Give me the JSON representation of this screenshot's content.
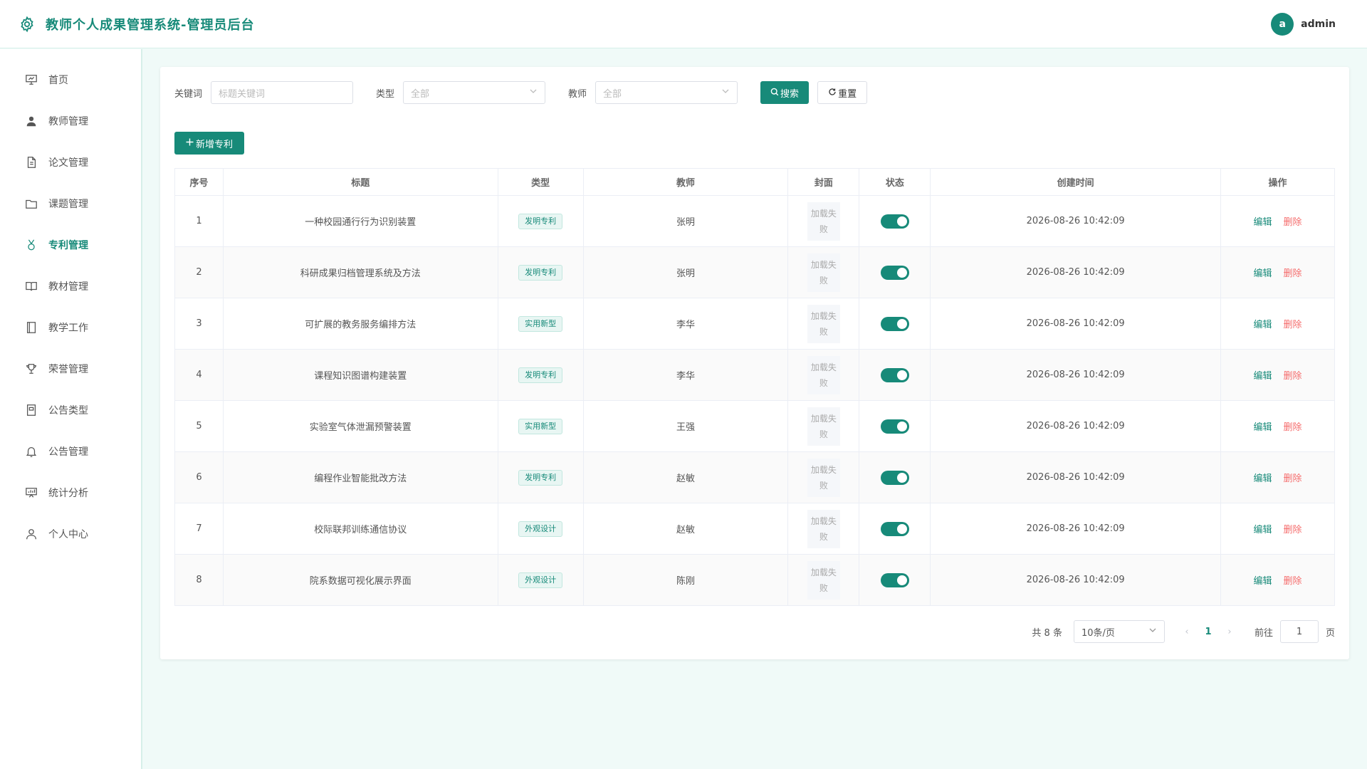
{
  "header": {
    "title": "教师个人成果管理系统-管理员后台",
    "avatar_letter": "a",
    "username": "admin"
  },
  "colors": {
    "primary": "#178a79",
    "danger": "#f56c6c"
  },
  "sidebar": {
    "items": [
      {
        "label": "首页",
        "icon": "dashboard-icon"
      },
      {
        "label": "教师管理",
        "icon": "user-icon"
      },
      {
        "label": "论文管理",
        "icon": "document-icon"
      },
      {
        "label": "课题管理",
        "icon": "folder-icon"
      },
      {
        "label": "专利管理",
        "icon": "badge-icon",
        "active": true
      },
      {
        "label": "教材管理",
        "icon": "book-icon"
      },
      {
        "label": "教学工作",
        "icon": "notebook-icon"
      },
      {
        "label": "荣誉管理",
        "icon": "trophy-icon"
      },
      {
        "label": "公告类型",
        "icon": "notice-type-icon"
      },
      {
        "label": "公告管理",
        "icon": "bell-icon"
      },
      {
        "label": "统计分析",
        "icon": "chart-icon"
      },
      {
        "label": "个人中心",
        "icon": "person-icon"
      }
    ]
  },
  "filters": {
    "keyword_label": "关键词",
    "keyword_placeholder": "标题关键词",
    "type_label": "类型",
    "type_value": "全部",
    "teacher_label": "教师",
    "teacher_value": "全部",
    "search_label": "搜索",
    "reset_label": "重置"
  },
  "add_button": "新增专利",
  "table": {
    "headers": [
      "序号",
      "标题",
      "类型",
      "教师",
      "封面",
      "状态",
      "创建时间",
      "操作"
    ],
    "cover_text": "加载失败",
    "edit_label": "编辑",
    "delete_label": "删除",
    "rows": [
      {
        "no": "1",
        "title": "一种校园通行行为识别装置",
        "type": "发明专利",
        "teacher": "张明",
        "enabled": true,
        "created": "2026-08-26 10:42:09"
      },
      {
        "no": "2",
        "title": "科研成果归档管理系统及方法",
        "type": "发明专利",
        "teacher": "张明",
        "enabled": true,
        "created": "2026-08-26 10:42:09"
      },
      {
        "no": "3",
        "title": "可扩展的教务服务编排方法",
        "type": "实用新型",
        "teacher": "李华",
        "enabled": true,
        "created": "2026-08-26 10:42:09"
      },
      {
        "no": "4",
        "title": "课程知识图谱构建装置",
        "type": "发明专利",
        "teacher": "李华",
        "enabled": true,
        "created": "2026-08-26 10:42:09"
      },
      {
        "no": "5",
        "title": "实验室气体泄漏预警装置",
        "type": "实用新型",
        "teacher": "王强",
        "enabled": true,
        "created": "2026-08-26 10:42:09"
      },
      {
        "no": "6",
        "title": "编程作业智能批改方法",
        "type": "发明专利",
        "teacher": "赵敏",
        "enabled": true,
        "created": "2026-08-26 10:42:09"
      },
      {
        "no": "7",
        "title": "校际联邦训练通信协议",
        "type": "外观设计",
        "teacher": "赵敏",
        "enabled": true,
        "created": "2026-08-26 10:42:09"
      },
      {
        "no": "8",
        "title": "院系数据可视化展示界面",
        "type": "外观设计",
        "teacher": "陈刚",
        "enabled": true,
        "created": "2026-08-26 10:42:09"
      }
    ]
  },
  "pagination": {
    "total_text": "共 8 条",
    "page_size": "10条/页",
    "current_page": "1",
    "goto_label": "前往",
    "goto_value": "1",
    "page_suffix": "页"
  }
}
